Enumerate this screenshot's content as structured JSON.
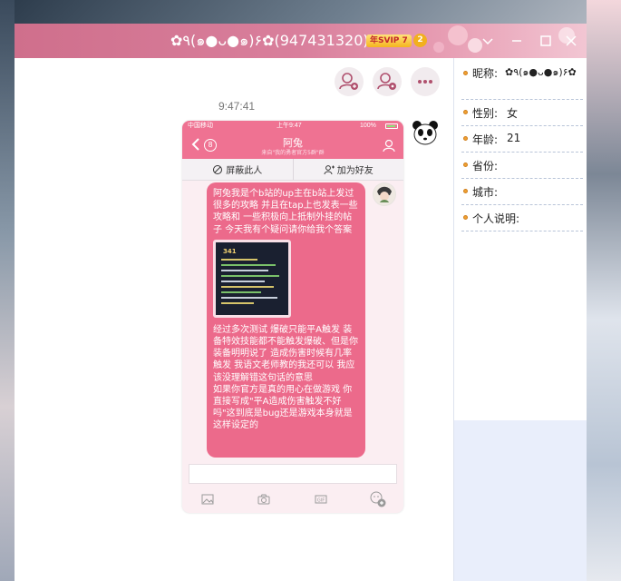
{
  "window": {
    "title": "✿٩(๑●ᴗ●๑)۶✿(947431320)",
    "vip_badge": "年SVIP 7",
    "level_badge": "2"
  },
  "toolbar": {
    "buttons": [
      "add-contact-icon",
      "user-settings-icon",
      "more-icon"
    ]
  },
  "chat": {
    "timestamp": "9:47:41"
  },
  "phone": {
    "status": {
      "carrier": "中国移动",
      "time": "上午9:47",
      "battery": "100%"
    },
    "nav": {
      "back_count": "8",
      "title": "阿兔",
      "subtitle": "来自\"我的勇者官方5群\"群"
    },
    "actions": {
      "block": "屏蔽此人",
      "add_friend": "加为好友"
    },
    "message": {
      "part1": "阿兔我是个b站的up主在b站上发过很多的攻略 并且在tap上也发表一些攻略和 一些积极向上抵制外挂的帖子 今天我有个疑问请你给我个答案",
      "part2": "经过多次测试 爆破只能平A触发 装备特效技能都不能触发爆破、但是你装备明明说了 造成伤害时候有几率触发 我语文老师教的我还可以 我应该没理解错这句话的意思\n如果你官方是真的用心在做游戏 你直接写成\"平A造成伤害触发不好吗\"这到底是bug还是游戏本身就是这样设定的",
      "image_label": "341"
    }
  },
  "profile": {
    "nickname_label": "昵称:",
    "nickname_value": "✿٩(๑●ᴗ●๑)۶✿",
    "gender_label": "性别:",
    "gender_value": "女",
    "age_label": "年龄:",
    "age_value": "21",
    "province_label": "省份:",
    "city_label": "城市:",
    "bio_label": "个人说明:"
  },
  "colors": {
    "titlebar": "#d97f9c",
    "bubble": "#ec6a8b",
    "phone_header": "#ef7292",
    "panel_bg": "#e9eefb"
  }
}
